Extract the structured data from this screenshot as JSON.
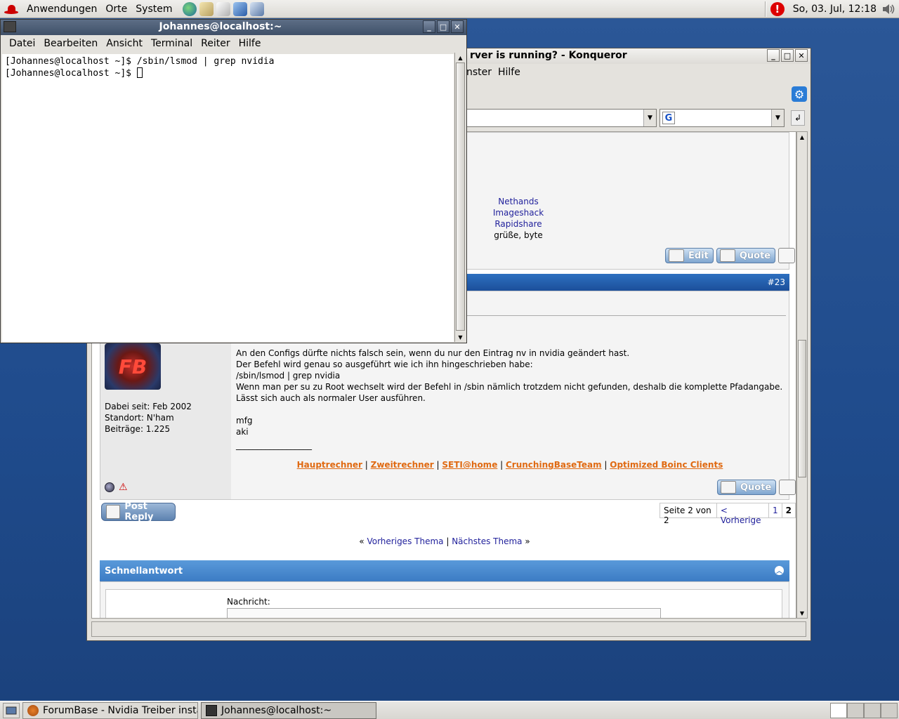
{
  "top_panel": {
    "menus": [
      "Anwendungen",
      "Orte",
      "System"
    ],
    "clock": "So, 03. Jul, 12:18",
    "launchers": [
      "web-browser-icon",
      "email-icon",
      "text-editor-icon",
      "office-icon",
      "print-manager-icon"
    ]
  },
  "terminal": {
    "title": "Johannes@localhost:~",
    "menu": [
      "Datei",
      "Bearbeiten",
      "Ansicht",
      "Terminal",
      "Reiter",
      "Hilfe"
    ],
    "lines": [
      "[Johannes@localhost ~]$ /sbin/lsmod | grep nvidia",
      "[Johannes@localhost ~]$ "
    ]
  },
  "konqueror": {
    "title": "rver is running? - Konqueror",
    "menu": [
      "nster",
      "Hilfe"
    ],
    "post1": {
      "sig_links": [
        "Nethands",
        "Imageshack",
        "Rapidshare"
      ],
      "greeting": "grüße, byte",
      "edit_label": "Edit",
      "quote_label": "Quote"
    },
    "post2": {
      "number": "#23",
      "user_info": [
        "Dabei seit: Feb 2002",
        "Standort: N'ham",
        "Beiträge: 1.225"
      ],
      "avatar_text": "FB",
      "text": [
        "An den Configs dürfte nichts falsch sein, wenn du nur den Eintrag nv in nvidia geändert hast.",
        "Der Befehl wird genau so ausgeführt wie ich ihn hingeschrieben habe:",
        "/sbin/lsmod | grep nvidia",
        "Wenn man per su zu Root wechselt wird der Befehl in /sbin nämlich trotzdem nicht gefunden, deshalb die komplette Pfadangabe. Lässt sich auch als normaler User ausführen.",
        "",
        "mfg",
        "aki"
      ],
      "sig_rule": "__________________",
      "sig_links": [
        "Hauptrechner",
        "Zweitrechner",
        "SETI@home",
        "CrunchingBaseTeam",
        "Optimized Boinc Clients"
      ],
      "quote_label": "Quote"
    },
    "post_reply_label": "Post Reply",
    "pagination": {
      "label": "Seite 2 von 2",
      "prev": "< Vorherige",
      "pages": [
        "1",
        "2"
      ]
    },
    "thread_nav": {
      "prev": "Vorheriges Thema",
      "next": "Nächstes Thema",
      "open": "«",
      "sep": "|",
      "close": "»"
    },
    "quick_reply": {
      "title": "Schnellantwort",
      "message_label": "Nachricht:"
    }
  },
  "taskbar": {
    "tasks": [
      "ForumBase - Nvidia Treiber installi...",
      "Johannes@localhost:~"
    ]
  }
}
